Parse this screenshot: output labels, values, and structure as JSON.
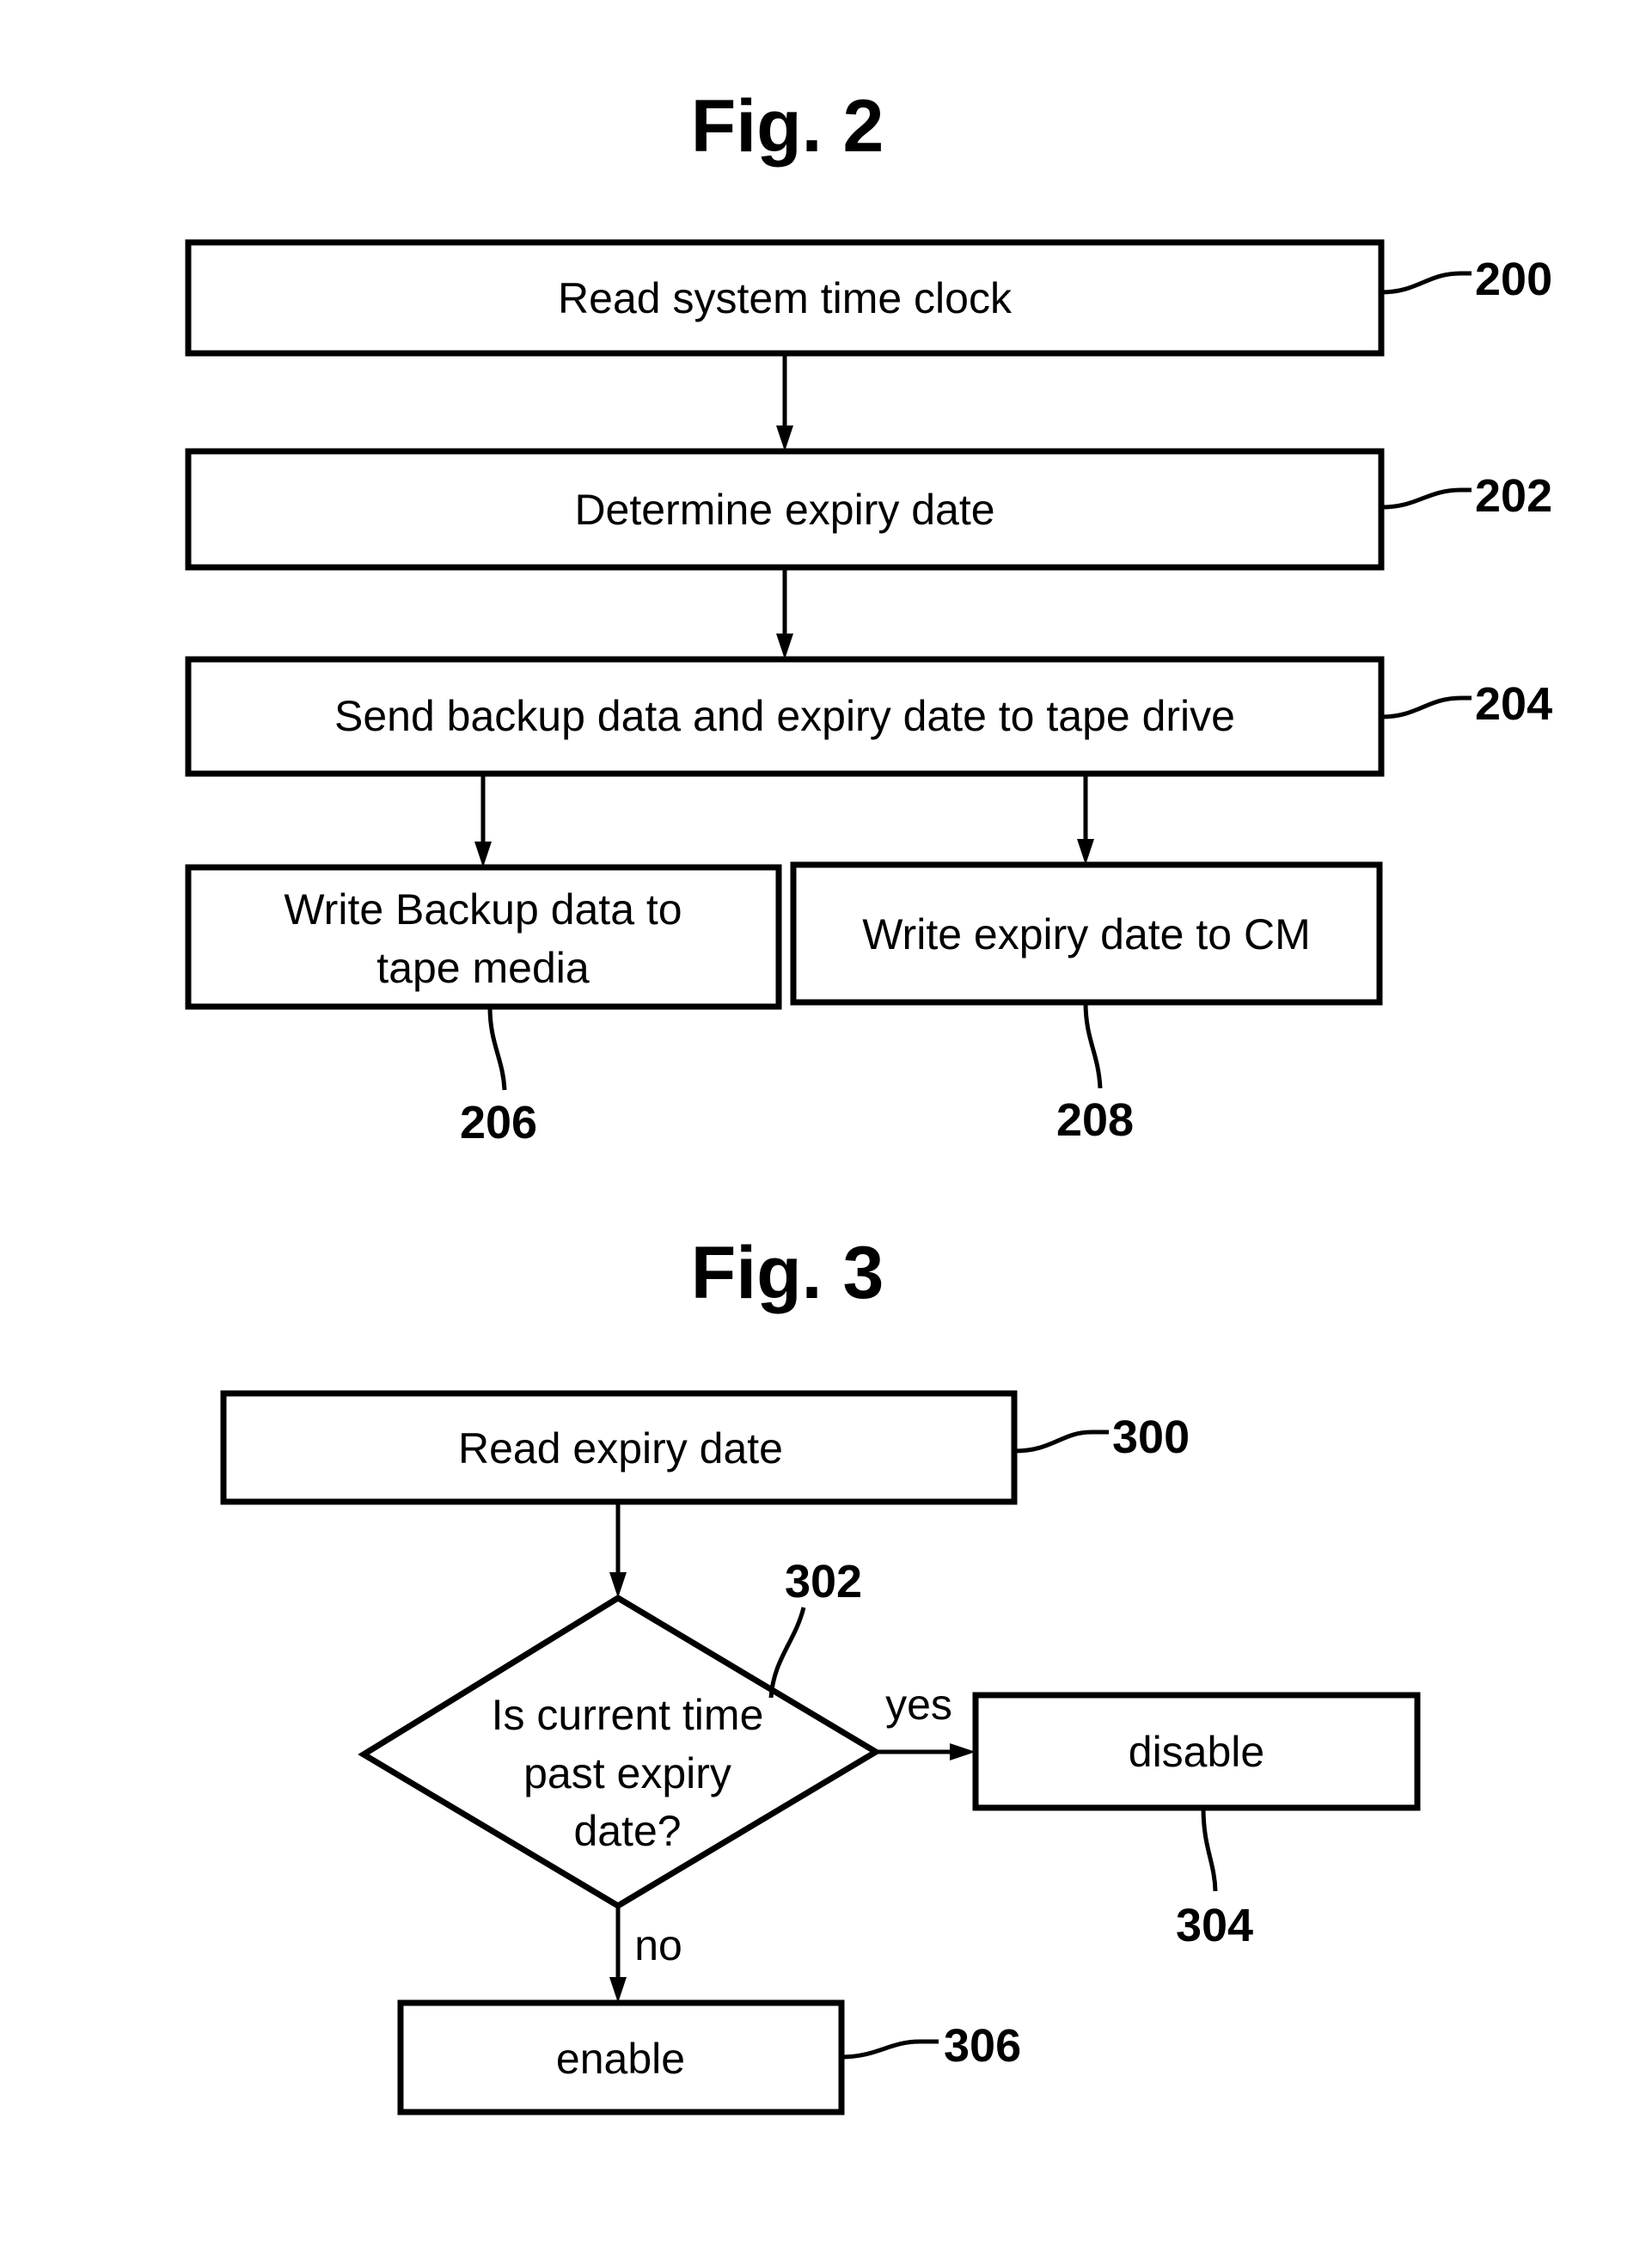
{
  "figures": [
    {
      "title": "Fig. 2",
      "nodes": [
        {
          "id": "200",
          "type": "process",
          "lines": [
            "Read system time clock"
          ]
        },
        {
          "id": "202",
          "type": "process",
          "lines": [
            "Determine expiry date"
          ]
        },
        {
          "id": "204",
          "type": "process",
          "lines": [
            "Send backup data and expiry date to tape drive"
          ]
        },
        {
          "id": "206",
          "type": "process",
          "lines": [
            "Write Backup data to",
            "tape media"
          ]
        },
        {
          "id": "208",
          "type": "process",
          "lines": [
            "Write expiry date to CM"
          ]
        }
      ],
      "edges": [
        {
          "from": "200",
          "to": "202",
          "label": ""
        },
        {
          "from": "202",
          "to": "204",
          "label": ""
        },
        {
          "from": "204",
          "to": "206",
          "label": ""
        },
        {
          "from": "204",
          "to": "208",
          "label": ""
        }
      ]
    },
    {
      "title": "Fig. 3",
      "nodes": [
        {
          "id": "300",
          "type": "process",
          "lines": [
            "Read expiry date"
          ]
        },
        {
          "id": "302",
          "type": "decision",
          "lines": [
            "Is current time",
            "past expiry",
            "date?"
          ]
        },
        {
          "id": "304",
          "type": "process",
          "lines": [
            "disable"
          ]
        },
        {
          "id": "306",
          "type": "process",
          "lines": [
            "enable"
          ]
        }
      ],
      "edges": [
        {
          "from": "300",
          "to": "302",
          "label": ""
        },
        {
          "from": "302",
          "to": "304",
          "label": "yes"
        },
        {
          "from": "302",
          "to": "306",
          "label": "no"
        }
      ]
    }
  ]
}
